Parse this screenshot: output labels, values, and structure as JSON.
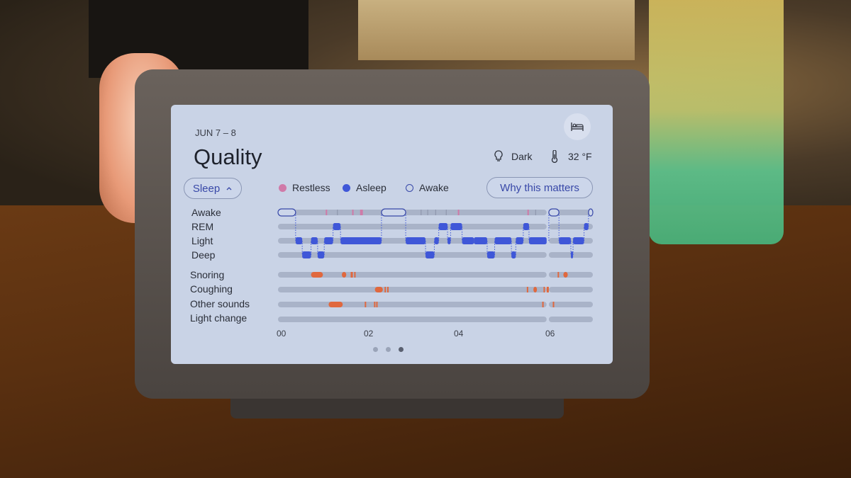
{
  "screen": {
    "date_range": "JUN 7 – 8",
    "title": "Quality",
    "bed_button_icon": "bed-icon",
    "conditions": [
      {
        "icon": "lightbulb-icon",
        "label": "Dark"
      },
      {
        "icon": "thermometer-icon",
        "label": "32 °F"
      }
    ],
    "filter_chip": {
      "label": "Sleep",
      "icon": "chevron-up-icon"
    },
    "legend": [
      {
        "label": "Restless",
        "color": "#d07aa8",
        "style": "filled"
      },
      {
        "label": "Asleep",
        "color": "#3f57d8",
        "style": "filled"
      },
      {
        "label": "Awake",
        "color": "#3848a8",
        "style": "outline"
      }
    ],
    "why_button": "Why this matters",
    "row_labels": [
      "Awake",
      "REM",
      "Light",
      "Deep",
      "Snoring",
      "Coughing",
      "Other sounds",
      "Light change"
    ],
    "axis_ticks": [
      {
        "label": "00",
        "hour": 0
      },
      {
        "label": "02",
        "hour": 2
      },
      {
        "label": "04",
        "hour": 4
      },
      {
        "label": "06",
        "hour": 6
      }
    ],
    "pager": {
      "count": 3,
      "active": 2
    }
  },
  "chart_data": {
    "type": "timeline",
    "title": "Quality",
    "x_unit": "hours since 00:00",
    "xlim": [
      -0.1,
      7.05
    ],
    "colors": {
      "asleep": "#3f57d8",
      "restless": "#d07aa8",
      "sound": "#e0683e",
      "track": "#a9b3c8",
      "awake_outline": "#3848a8"
    },
    "stages": [
      "Awake",
      "REM",
      "Light",
      "Deep"
    ],
    "hypnogram": [
      {
        "stage": "Awake",
        "start": -0.1,
        "end": 0.3
      },
      {
        "stage": "Light",
        "start": 0.3,
        "end": 0.45
      },
      {
        "stage": "Deep",
        "start": 0.45,
        "end": 0.65
      },
      {
        "stage": "Light",
        "start": 0.65,
        "end": 0.8
      },
      {
        "stage": "Deep",
        "start": 0.8,
        "end": 0.95
      },
      {
        "stage": "Light",
        "start": 0.95,
        "end": 1.15
      },
      {
        "stage": "REM",
        "start": 1.15,
        "end": 1.32
      },
      {
        "stage": "Light",
        "start": 1.32,
        "end": 2.25
      },
      {
        "stage": "Awake",
        "start": 2.25,
        "end": 2.8
      },
      {
        "stage": "Light",
        "start": 2.8,
        "end": 3.25
      },
      {
        "stage": "Deep",
        "start": 3.25,
        "end": 3.45
      },
      {
        "stage": "Light",
        "start": 3.45,
        "end": 3.55
      },
      {
        "stage": "REM",
        "start": 3.55,
        "end": 3.75
      },
      {
        "stage": "Light",
        "start": 3.75,
        "end": 3.82
      },
      {
        "stage": "REM",
        "start": 3.82,
        "end": 4.08
      },
      {
        "stage": "Light",
        "start": 4.08,
        "end": 4.35
      },
      {
        "stage": "Light",
        "start": 4.35,
        "end": 4.65
      },
      {
        "stage": "Deep",
        "start": 4.65,
        "end": 4.82
      },
      {
        "stage": "Light",
        "start": 4.82,
        "end": 5.2
      },
      {
        "stage": "Deep",
        "start": 5.2,
        "end": 5.3
      },
      {
        "stage": "Light",
        "start": 5.3,
        "end": 5.47
      },
      {
        "stage": "REM",
        "start": 5.47,
        "end": 5.6
      },
      {
        "stage": "Light",
        "start": 5.6,
        "end": 6.0
      },
      {
        "stage": "Awake",
        "start": 6.05,
        "end": 6.28
      },
      {
        "stage": "Light",
        "start": 6.28,
        "end": 6.55
      },
      {
        "stage": "Deep",
        "start": 6.55,
        "end": 6.6
      },
      {
        "stage": "Light",
        "start": 6.6,
        "end": 6.85
      },
      {
        "stage": "REM",
        "start": 6.85,
        "end": 6.95
      },
      {
        "stage": "Awake",
        "start": 6.95,
        "end": 7.05
      }
    ],
    "track_gaps": [
      {
        "start": 6.0,
        "end": 6.05
      }
    ],
    "restless_marks": [
      1.0,
      1.6,
      1.78,
      1.81,
      4.0,
      5.58,
      6.22
    ],
    "awake_ticks": [
      1.25,
      3.15,
      3.3,
      3.48,
      3.72,
      5.75
    ],
    "sound_events": {
      "Snoring": [
        {
          "start": 0.65,
          "end": 0.92
        },
        {
          "start": 1.35,
          "end": 1.45
        },
        {
          "start": 1.55,
          "end": 1.6
        },
        {
          "start": 1.63,
          "end": 1.64
        },
        {
          "start": 6.25,
          "end": 6.26
        },
        {
          "start": 6.38,
          "end": 6.48
        }
      ],
      "Coughing": [
        {
          "start": 2.1,
          "end": 2.28
        },
        {
          "start": 2.32,
          "end": 2.34
        },
        {
          "start": 2.38,
          "end": 2.4
        },
        {
          "start": 5.55,
          "end": 5.56
        },
        {
          "start": 5.7,
          "end": 5.78
        },
        {
          "start": 5.93,
          "end": 5.94
        },
        {
          "start": 6.0,
          "end": 6.05
        }
      ],
      "Other sounds": [
        {
          "start": 1.05,
          "end": 1.37
        },
        {
          "start": 1.87,
          "end": 1.88
        },
        {
          "start": 2.08,
          "end": 2.09
        },
        {
          "start": 2.13,
          "end": 2.14
        },
        {
          "start": 5.9,
          "end": 5.91
        },
        {
          "start": 6.14,
          "end": 6.15
        }
      ],
      "Light change": []
    }
  }
}
